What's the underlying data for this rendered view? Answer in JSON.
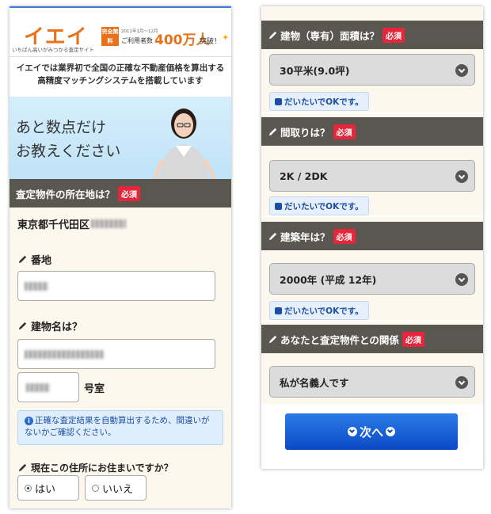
{
  "header": {
    "logo": "イエイ",
    "logo_subtitle": "いちばん高いがみつかる査定サイト",
    "badge": "完全無料",
    "users_small": "2011年1月〜12月",
    "users_label": "ご利用者数",
    "users_count": "400万人",
    "users_suffix": "突破！"
  },
  "intro": "イエイでは業界初で全国の正確な不動産価格を算出する高精度マッチングシステムを搭載しています",
  "hero": {
    "line1": "あと数点だけ",
    "line2": "お教えください"
  },
  "location": {
    "title": "査定物件の所在地は？",
    "required": "必須",
    "address": "東京都千代田区"
  },
  "banchi": {
    "label": "番地"
  },
  "building": {
    "label": "建物名は？",
    "room_suffix": "号室"
  },
  "notice": "正確な査定結果を自動算出するため、間違いがないかご確認ください。",
  "residence": {
    "question": "現在この住所にお住まいですか？",
    "options": [
      "はい",
      "いいえ"
    ],
    "selected": "はい"
  },
  "area": {
    "title": "建物（専有）面積は？",
    "required": "必須",
    "value": "30平米(9.0坪)",
    "hint": "だいたいでOKです。"
  },
  "layout": {
    "title": "間取りは？",
    "required": "必須",
    "value": "2K / 2DK",
    "hint": "だいたいでOKです。"
  },
  "built": {
    "title": "建築年は？",
    "required": "必須",
    "value": "2000年 (平成 12年)",
    "hint": "だいたいでOKです。"
  },
  "relation": {
    "title": "あなたと査定物件との関係",
    "required": "必須",
    "value": "私が名義人です"
  },
  "next_button": "次へ",
  "colors": {
    "accent": "#e8721c",
    "section_bar": "#5a5751",
    "required": "#e6263b",
    "button": "#0a49c4"
  }
}
